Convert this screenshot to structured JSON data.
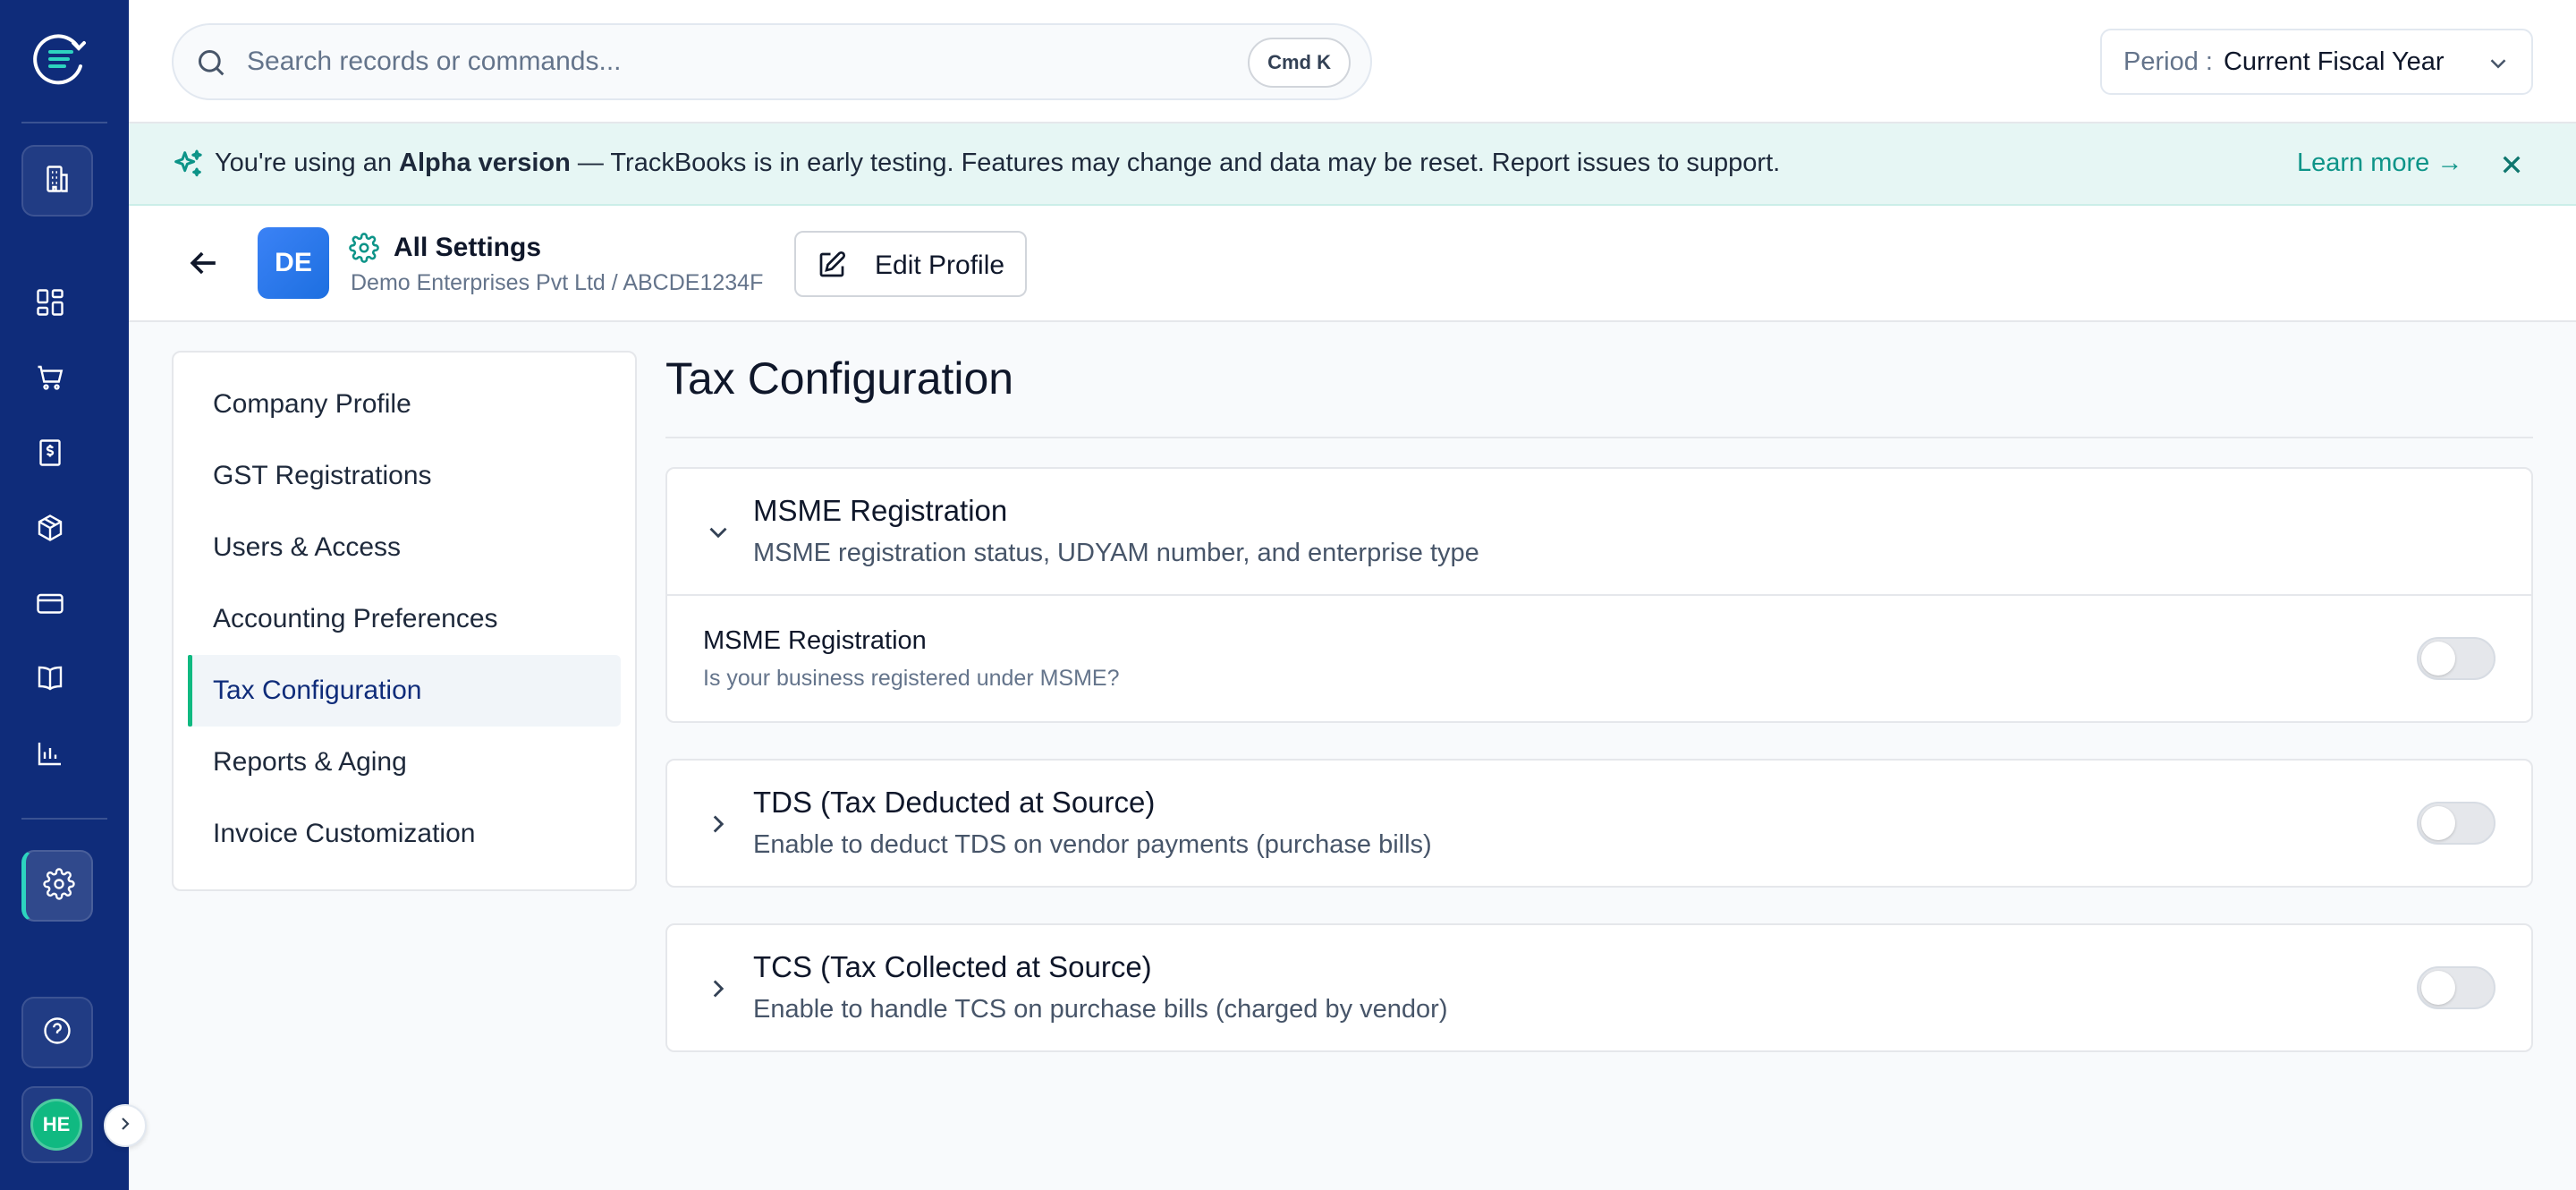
{
  "app": {
    "name": "TrackBooks",
    "accent_color": "#0d9488",
    "sidebar_color": "#0f2c7a"
  },
  "sidebar": {
    "items": [
      {
        "name": "company",
        "icon": "building-icon"
      },
      {
        "name": "dashboard",
        "icon": "grid-icon"
      },
      {
        "name": "sales",
        "icon": "cart-icon"
      },
      {
        "name": "invoices",
        "icon": "receipt-dollar-icon"
      },
      {
        "name": "inventory",
        "icon": "box-icon"
      },
      {
        "name": "payments",
        "icon": "card-icon"
      },
      {
        "name": "ledger",
        "icon": "book-icon"
      },
      {
        "name": "reports",
        "icon": "bar-chart-icon"
      },
      {
        "name": "settings",
        "icon": "gear-icon",
        "active": true
      },
      {
        "name": "help",
        "icon": "help-circle-icon"
      }
    ],
    "user_initials": "HE"
  },
  "search": {
    "placeholder": "Search records or commands...",
    "shortcut": "Cmd K"
  },
  "period": {
    "label": "Period :",
    "value": "Current Fiscal Year"
  },
  "banner": {
    "prefix": "You're using an ",
    "bold": "Alpha version",
    "suffix": " — TrackBooks is in early testing. Features may change and data may be reset. Report issues to support.",
    "link": "Learn more →"
  },
  "header": {
    "company_initials": "DE",
    "title": "All Settings",
    "company_name": "Demo Enterprises Pvt Ltd",
    "separator": "/",
    "company_id": "ABCDE1234F",
    "edit_label": "Edit Profile"
  },
  "settings_nav": [
    {
      "label": "Company Profile",
      "active": false
    },
    {
      "label": "GST Registrations",
      "active": false
    },
    {
      "label": "Users & Access",
      "active": false
    },
    {
      "label": "Accounting Preferences",
      "active": false
    },
    {
      "label": "Tax Configuration",
      "active": true
    },
    {
      "label": "Reports & Aging",
      "active": false
    },
    {
      "label": "Invoice Customization",
      "active": false
    }
  ],
  "main": {
    "title": "Tax Configuration",
    "sections": [
      {
        "title": "MSME Registration",
        "description": "MSME registration status, UDYAM number, and enterprise type",
        "expanded": true,
        "row": {
          "title": "MSME Registration",
          "subtitle": "Is your business registered under MSME?",
          "enabled": false
        }
      },
      {
        "title": "TDS (Tax Deducted at Source)",
        "description": "Enable to deduct TDS on vendor payments (purchase bills)",
        "expanded": false,
        "enabled": false
      },
      {
        "title": "TCS (Tax Collected at Source)",
        "description": "Enable to handle TCS on purchase bills (charged by vendor)",
        "expanded": false,
        "enabled": false
      }
    ]
  }
}
